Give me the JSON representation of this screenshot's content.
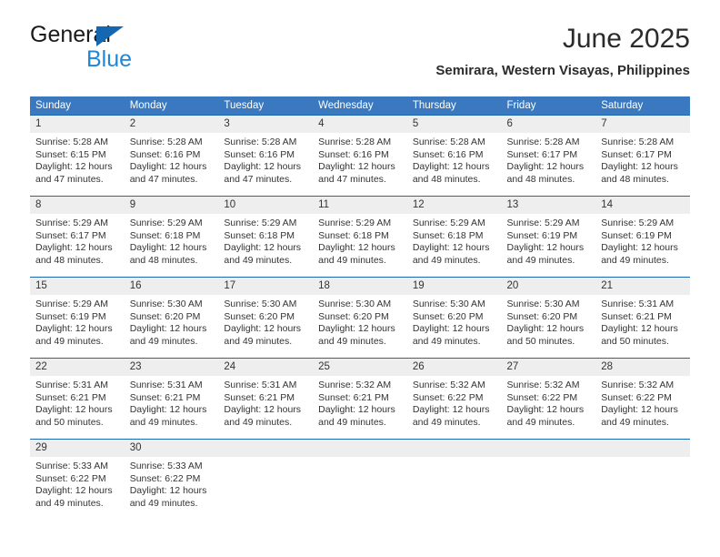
{
  "brand": {
    "line1": "General",
    "line2": "Blue",
    "triangle_color": "#1667b2"
  },
  "header": {
    "title": "June 2025",
    "subtitle": "Semirara, Western Visayas, Philippines"
  },
  "theme": {
    "header_bg": "#3a78bf",
    "row_divider": "#1f68ae",
    "daynum_bg": "#eeeeee"
  },
  "calendar": {
    "weekday_headers": [
      "Sunday",
      "Monday",
      "Tuesday",
      "Wednesday",
      "Thursday",
      "Friday",
      "Saturday"
    ],
    "labels": {
      "sunrise_prefix": "Sunrise: ",
      "sunset_prefix": "Sunset: ",
      "daylight_prefix": "Daylight: "
    },
    "weeks": [
      [
        {
          "day": "1",
          "sunrise": "Sunrise: 5:28 AM",
          "sunset": "Sunset: 6:15 PM",
          "daylight_line1": "Daylight: 12 hours",
          "daylight_line2": "and 47 minutes."
        },
        {
          "day": "2",
          "sunrise": "Sunrise: 5:28 AM",
          "sunset": "Sunset: 6:16 PM",
          "daylight_line1": "Daylight: 12 hours",
          "daylight_line2": "and 47 minutes."
        },
        {
          "day": "3",
          "sunrise": "Sunrise: 5:28 AM",
          "sunset": "Sunset: 6:16 PM",
          "daylight_line1": "Daylight: 12 hours",
          "daylight_line2": "and 47 minutes."
        },
        {
          "day": "4",
          "sunrise": "Sunrise: 5:28 AM",
          "sunset": "Sunset: 6:16 PM",
          "daylight_line1": "Daylight: 12 hours",
          "daylight_line2": "and 47 minutes."
        },
        {
          "day": "5",
          "sunrise": "Sunrise: 5:28 AM",
          "sunset": "Sunset: 6:16 PM",
          "daylight_line1": "Daylight: 12 hours",
          "daylight_line2": "and 48 minutes."
        },
        {
          "day": "6",
          "sunrise": "Sunrise: 5:28 AM",
          "sunset": "Sunset: 6:17 PM",
          "daylight_line1": "Daylight: 12 hours",
          "daylight_line2": "and 48 minutes."
        },
        {
          "day": "7",
          "sunrise": "Sunrise: 5:28 AM",
          "sunset": "Sunset: 6:17 PM",
          "daylight_line1": "Daylight: 12 hours",
          "daylight_line2": "and 48 minutes."
        }
      ],
      [
        {
          "day": "8",
          "sunrise": "Sunrise: 5:29 AM",
          "sunset": "Sunset: 6:17 PM",
          "daylight_line1": "Daylight: 12 hours",
          "daylight_line2": "and 48 minutes."
        },
        {
          "day": "9",
          "sunrise": "Sunrise: 5:29 AM",
          "sunset": "Sunset: 6:18 PM",
          "daylight_line1": "Daylight: 12 hours",
          "daylight_line2": "and 48 minutes."
        },
        {
          "day": "10",
          "sunrise": "Sunrise: 5:29 AM",
          "sunset": "Sunset: 6:18 PM",
          "daylight_line1": "Daylight: 12 hours",
          "daylight_line2": "and 49 minutes."
        },
        {
          "day": "11",
          "sunrise": "Sunrise: 5:29 AM",
          "sunset": "Sunset: 6:18 PM",
          "daylight_line1": "Daylight: 12 hours",
          "daylight_line2": "and 49 minutes."
        },
        {
          "day": "12",
          "sunrise": "Sunrise: 5:29 AM",
          "sunset": "Sunset: 6:18 PM",
          "daylight_line1": "Daylight: 12 hours",
          "daylight_line2": "and 49 minutes."
        },
        {
          "day": "13",
          "sunrise": "Sunrise: 5:29 AM",
          "sunset": "Sunset: 6:19 PM",
          "daylight_line1": "Daylight: 12 hours",
          "daylight_line2": "and 49 minutes."
        },
        {
          "day": "14",
          "sunrise": "Sunrise: 5:29 AM",
          "sunset": "Sunset: 6:19 PM",
          "daylight_line1": "Daylight: 12 hours",
          "daylight_line2": "and 49 minutes."
        }
      ],
      [
        {
          "day": "15",
          "sunrise": "Sunrise: 5:29 AM",
          "sunset": "Sunset: 6:19 PM",
          "daylight_line1": "Daylight: 12 hours",
          "daylight_line2": "and 49 minutes."
        },
        {
          "day": "16",
          "sunrise": "Sunrise: 5:30 AM",
          "sunset": "Sunset: 6:20 PM",
          "daylight_line1": "Daylight: 12 hours",
          "daylight_line2": "and 49 minutes."
        },
        {
          "day": "17",
          "sunrise": "Sunrise: 5:30 AM",
          "sunset": "Sunset: 6:20 PM",
          "daylight_line1": "Daylight: 12 hours",
          "daylight_line2": "and 49 minutes."
        },
        {
          "day": "18",
          "sunrise": "Sunrise: 5:30 AM",
          "sunset": "Sunset: 6:20 PM",
          "daylight_line1": "Daylight: 12 hours",
          "daylight_line2": "and 49 minutes."
        },
        {
          "day": "19",
          "sunrise": "Sunrise: 5:30 AM",
          "sunset": "Sunset: 6:20 PM",
          "daylight_line1": "Daylight: 12 hours",
          "daylight_line2": "and 49 minutes."
        },
        {
          "day": "20",
          "sunrise": "Sunrise: 5:30 AM",
          "sunset": "Sunset: 6:20 PM",
          "daylight_line1": "Daylight: 12 hours",
          "daylight_line2": "and 50 minutes."
        },
        {
          "day": "21",
          "sunrise": "Sunrise: 5:31 AM",
          "sunset": "Sunset: 6:21 PM",
          "daylight_line1": "Daylight: 12 hours",
          "daylight_line2": "and 50 minutes."
        }
      ],
      [
        {
          "day": "22",
          "sunrise": "Sunrise: 5:31 AM",
          "sunset": "Sunset: 6:21 PM",
          "daylight_line1": "Daylight: 12 hours",
          "daylight_line2": "and 50 minutes."
        },
        {
          "day": "23",
          "sunrise": "Sunrise: 5:31 AM",
          "sunset": "Sunset: 6:21 PM",
          "daylight_line1": "Daylight: 12 hours",
          "daylight_line2": "and 49 minutes."
        },
        {
          "day": "24",
          "sunrise": "Sunrise: 5:31 AM",
          "sunset": "Sunset: 6:21 PM",
          "daylight_line1": "Daylight: 12 hours",
          "daylight_line2": "and 49 minutes."
        },
        {
          "day": "25",
          "sunrise": "Sunrise: 5:32 AM",
          "sunset": "Sunset: 6:21 PM",
          "daylight_line1": "Daylight: 12 hours",
          "daylight_line2": "and 49 minutes."
        },
        {
          "day": "26",
          "sunrise": "Sunrise: 5:32 AM",
          "sunset": "Sunset: 6:22 PM",
          "daylight_line1": "Daylight: 12 hours",
          "daylight_line2": "and 49 minutes."
        },
        {
          "day": "27",
          "sunrise": "Sunrise: 5:32 AM",
          "sunset": "Sunset: 6:22 PM",
          "daylight_line1": "Daylight: 12 hours",
          "daylight_line2": "and 49 minutes."
        },
        {
          "day": "28",
          "sunrise": "Sunrise: 5:32 AM",
          "sunset": "Sunset: 6:22 PM",
          "daylight_line1": "Daylight: 12 hours",
          "daylight_line2": "and 49 minutes."
        }
      ],
      [
        {
          "day": "29",
          "sunrise": "Sunrise: 5:33 AM",
          "sunset": "Sunset: 6:22 PM",
          "daylight_line1": "Daylight: 12 hours",
          "daylight_line2": "and 49 minutes."
        },
        {
          "day": "30",
          "sunrise": "Sunrise: 5:33 AM",
          "sunset": "Sunset: 6:22 PM",
          "daylight_line1": "Daylight: 12 hours",
          "daylight_line2": "and 49 minutes."
        },
        {
          "day": "",
          "sunrise": "",
          "sunset": "",
          "daylight_line1": "",
          "daylight_line2": ""
        },
        {
          "day": "",
          "sunrise": "",
          "sunset": "",
          "daylight_line1": "",
          "daylight_line2": ""
        },
        {
          "day": "",
          "sunrise": "",
          "sunset": "",
          "daylight_line1": "",
          "daylight_line2": ""
        },
        {
          "day": "",
          "sunrise": "",
          "sunset": "",
          "daylight_line1": "",
          "daylight_line2": ""
        },
        {
          "day": "",
          "sunrise": "",
          "sunset": "",
          "daylight_line1": "",
          "daylight_line2": ""
        }
      ]
    ]
  }
}
